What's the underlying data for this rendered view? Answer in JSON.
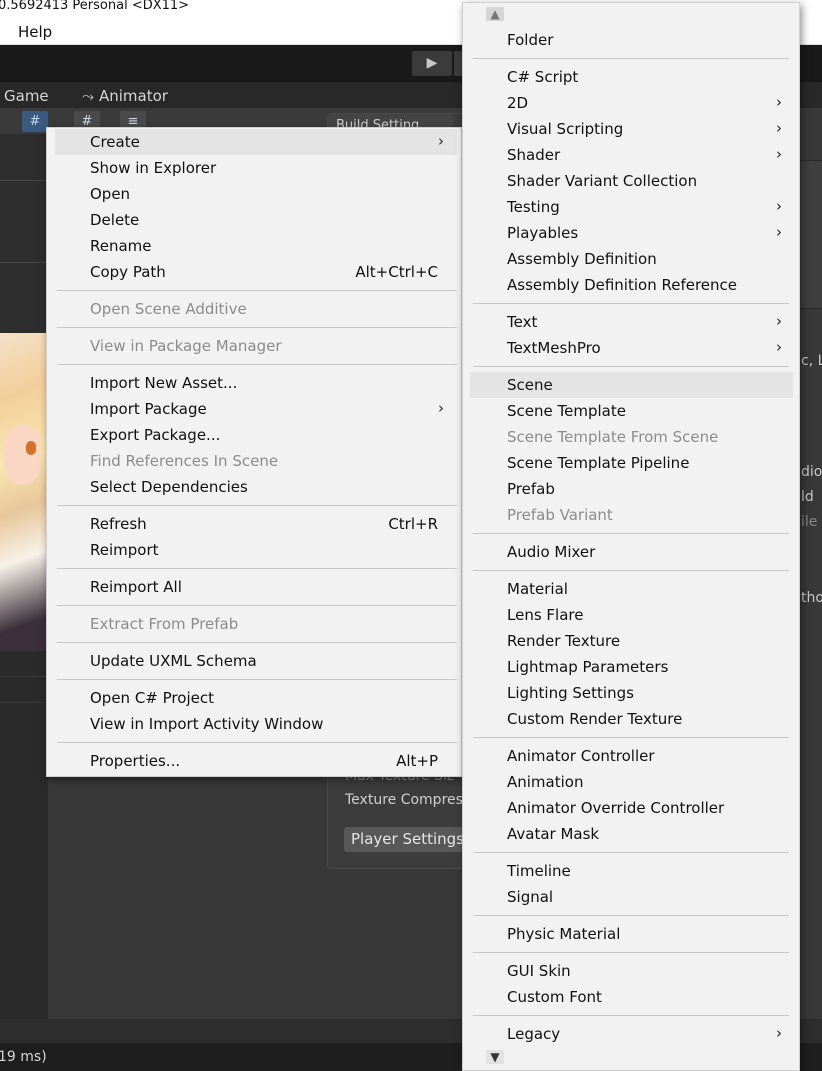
{
  "window": {
    "title": "0.5692413 Personal <DX11>"
  },
  "menubar": {
    "help": "Help"
  },
  "toolbar": {
    "play_icon": "play-icon",
    "play_glyph": "▶"
  },
  "tabs": {
    "game": "Game",
    "animator": "Animator",
    "animator_glyph": "⤳"
  },
  "build_panel": {
    "title": "Build Setting",
    "max_texture": "Max Texture Siz",
    "texture_compress": "Texture Compres",
    "player_settings": "Player Settings..."
  },
  "right_panel": {
    "t1": "c, L",
    "t2": "dio",
    "t3": "ld",
    "t4": "ile",
    "t5": "tho"
  },
  "status_bar": {
    "text": "19 ms)"
  },
  "context_menu": {
    "items": [
      {
        "label": "Create",
        "shortcut": "",
        "submenu": true,
        "disabled": false,
        "highlighted": true
      },
      {
        "label": "Show in Explorer",
        "shortcut": "",
        "submenu": false,
        "disabled": false
      },
      {
        "label": "Open",
        "shortcut": "",
        "submenu": false,
        "disabled": false
      },
      {
        "label": "Delete",
        "shortcut": "",
        "submenu": false,
        "disabled": false
      },
      {
        "label": "Rename",
        "shortcut": "",
        "submenu": false,
        "disabled": false
      },
      {
        "label": "Copy Path",
        "shortcut": "Alt+Ctrl+C",
        "submenu": false,
        "disabled": false
      },
      {
        "label": "Open Scene Additive",
        "shortcut": "",
        "submenu": false,
        "disabled": true
      },
      {
        "label": "View in Package Manager",
        "shortcut": "",
        "submenu": false,
        "disabled": true
      },
      {
        "label": "Import New Asset...",
        "shortcut": "",
        "submenu": false,
        "disabled": false
      },
      {
        "label": "Import Package",
        "shortcut": "",
        "submenu": true,
        "disabled": false
      },
      {
        "label": "Export Package...",
        "shortcut": "",
        "submenu": false,
        "disabled": false
      },
      {
        "label": "Find References In Scene",
        "shortcut": "",
        "submenu": false,
        "disabled": true
      },
      {
        "label": "Select Dependencies",
        "shortcut": "",
        "submenu": false,
        "disabled": false
      },
      {
        "label": "Refresh",
        "shortcut": "Ctrl+R",
        "submenu": false,
        "disabled": false
      },
      {
        "label": "Reimport",
        "shortcut": "",
        "submenu": false,
        "disabled": false
      },
      {
        "label": "Reimport All",
        "shortcut": "",
        "submenu": false,
        "disabled": false
      },
      {
        "label": "Extract From Prefab",
        "shortcut": "",
        "submenu": false,
        "disabled": true
      },
      {
        "label": "Update UXML Schema",
        "shortcut": "",
        "submenu": false,
        "disabled": false
      },
      {
        "label": "Open C# Project",
        "shortcut": "",
        "submenu": false,
        "disabled": false
      },
      {
        "label": "View in Import Activity Window",
        "shortcut": "",
        "submenu": false,
        "disabled": false
      },
      {
        "label": "Properties...",
        "shortcut": "Alt+P",
        "submenu": false,
        "disabled": false
      }
    ]
  },
  "create_submenu": {
    "items": [
      {
        "label": "Folder",
        "submenu": false,
        "disabled": false
      },
      {
        "label": "C# Script",
        "submenu": false,
        "disabled": false
      },
      {
        "label": "2D",
        "submenu": true,
        "disabled": false
      },
      {
        "label": "Visual Scripting",
        "submenu": true,
        "disabled": false
      },
      {
        "label": "Shader",
        "submenu": true,
        "disabled": false
      },
      {
        "label": "Shader Variant Collection",
        "submenu": false,
        "disabled": false
      },
      {
        "label": "Testing",
        "submenu": true,
        "disabled": false
      },
      {
        "label": "Playables",
        "submenu": true,
        "disabled": false
      },
      {
        "label": "Assembly Definition",
        "submenu": false,
        "disabled": false
      },
      {
        "label": "Assembly Definition Reference",
        "submenu": false,
        "disabled": false
      },
      {
        "label": "Text",
        "submenu": true,
        "disabled": false
      },
      {
        "label": "TextMeshPro",
        "submenu": true,
        "disabled": false
      },
      {
        "label": "Scene",
        "submenu": false,
        "disabled": false,
        "highlighted": true
      },
      {
        "label": "Scene Template",
        "submenu": false,
        "disabled": false
      },
      {
        "label": "Scene Template From Scene",
        "submenu": false,
        "disabled": true
      },
      {
        "label": "Scene Template Pipeline",
        "submenu": false,
        "disabled": false
      },
      {
        "label": "Prefab",
        "submenu": false,
        "disabled": false
      },
      {
        "label": "Prefab Variant",
        "submenu": false,
        "disabled": true
      },
      {
        "label": "Audio Mixer",
        "submenu": false,
        "disabled": false
      },
      {
        "label": "Material",
        "submenu": false,
        "disabled": false
      },
      {
        "label": "Lens Flare",
        "submenu": false,
        "disabled": false
      },
      {
        "label": "Render Texture",
        "submenu": false,
        "disabled": false
      },
      {
        "label": "Lightmap Parameters",
        "submenu": false,
        "disabled": false
      },
      {
        "label": "Lighting Settings",
        "submenu": false,
        "disabled": false
      },
      {
        "label": "Custom Render Texture",
        "submenu": false,
        "disabled": false
      },
      {
        "label": "Animator Controller",
        "submenu": false,
        "disabled": false
      },
      {
        "label": "Animation",
        "submenu": false,
        "disabled": false
      },
      {
        "label": "Animator Override Controller",
        "submenu": false,
        "disabled": false
      },
      {
        "label": "Avatar Mask",
        "submenu": false,
        "disabled": false
      },
      {
        "label": "Timeline",
        "submenu": false,
        "disabled": false
      },
      {
        "label": "Signal",
        "submenu": false,
        "disabled": false
      },
      {
        "label": "Physic Material",
        "submenu": false,
        "disabled": false
      },
      {
        "label": "GUI Skin",
        "submenu": false,
        "disabled": false
      },
      {
        "label": "Custom Font",
        "submenu": false,
        "disabled": false
      },
      {
        "label": "Legacy",
        "submenu": true,
        "disabled": false
      }
    ],
    "scroll_up_glyph": "▲",
    "scroll_down_glyph": "▼"
  },
  "icons": {
    "submenu_arrow": "chevron-right-icon",
    "submenu_arrow_glyph": "›"
  },
  "colors": {
    "menu_bg": "#f2f2f2",
    "highlight": "#e4e4e4",
    "disabled_text": "#8c8c8c",
    "editor_bg": "#383838"
  }
}
